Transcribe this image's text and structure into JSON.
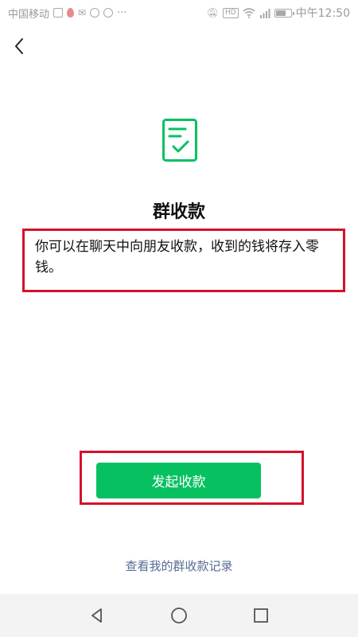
{
  "status_bar": {
    "carrier": "中国移动",
    "more": "···",
    "hd_badge": "HD",
    "time": "中午12:50"
  },
  "icons": {
    "back": "chevron-left-icon",
    "document": "document-check-icon",
    "nav_back": "triangle-back-icon",
    "nav_home": "circle-home-icon",
    "nav_recent": "square-recent-icon"
  },
  "colors": {
    "accent_green": "#07c160",
    "link_blue": "#576b95",
    "highlight_red": "#d4122b"
  },
  "page": {
    "title": "群收款",
    "description": "你可以在聊天中向朋友收款，收到的钱将存入零钱。",
    "primary_button": "发起收款",
    "records_link": "查看我的群收款记录"
  }
}
